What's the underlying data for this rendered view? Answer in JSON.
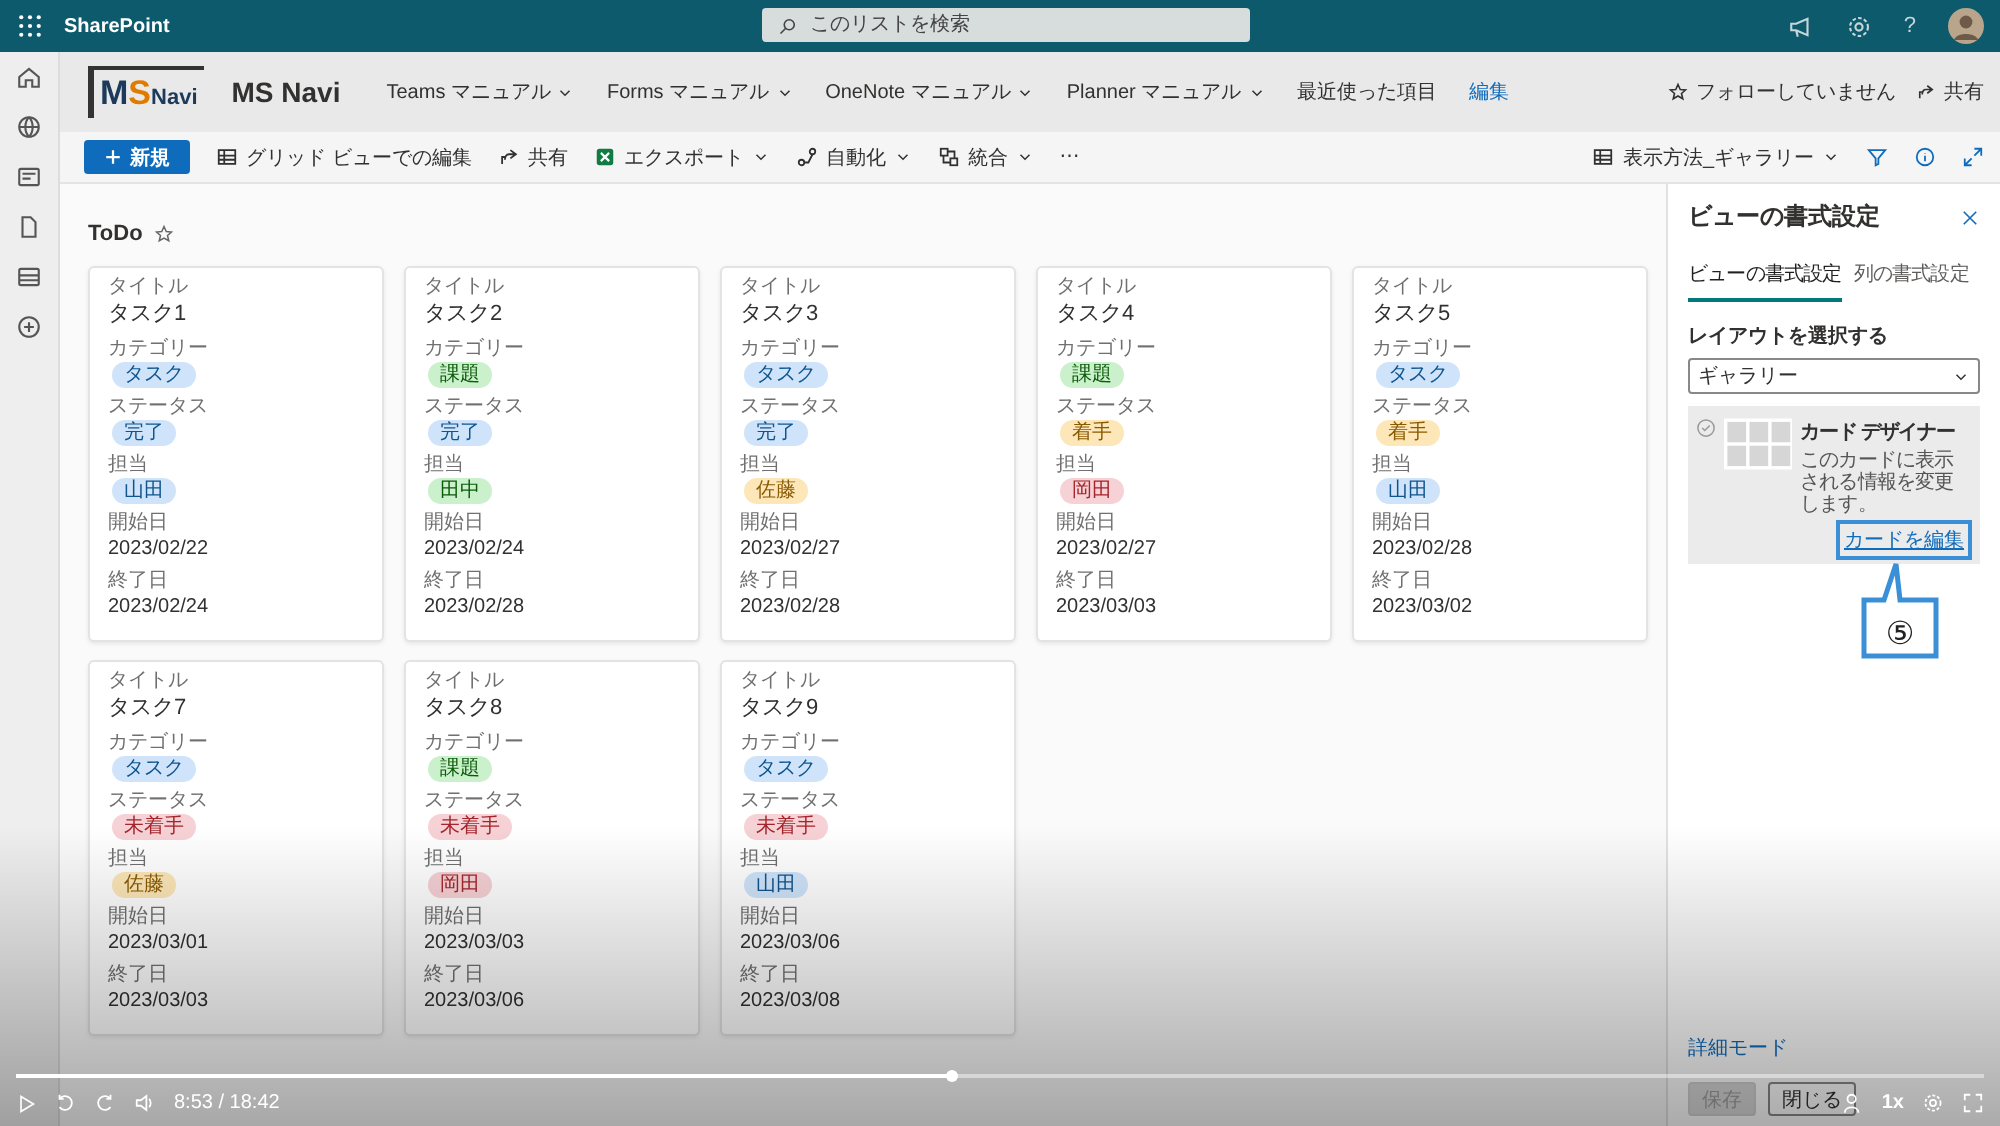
{
  "suite_bar": {
    "app_name": "SharePoint",
    "search": {
      "placeholder": "このリストを検索"
    },
    "help": "?"
  },
  "site_header": {
    "logo": {
      "mark": "M",
      "accent": "S",
      "name": "Navi"
    },
    "title": "MS Navi",
    "nav": [
      {
        "label": "Teams マニュアル",
        "kind": "menu"
      },
      {
        "label": "Forms マニュアル",
        "kind": "menu"
      },
      {
        "label": "OneNote マニュアル",
        "kind": "menu"
      },
      {
        "label": "Planner マニュアル",
        "kind": "menu"
      },
      {
        "label": "最近使った項目",
        "kind": "plain"
      },
      {
        "label": "編集",
        "kind": "link"
      }
    ],
    "follow": "フォローしていません",
    "share": "共有"
  },
  "command_bar": {
    "items": [
      {
        "label": "新規",
        "kind": "new"
      },
      {
        "label": "グリッド ビューでの編集",
        "kind": "grid"
      },
      {
        "label": "共有",
        "kind": "share"
      },
      {
        "label": "エクスポート",
        "kind": "excel"
      },
      {
        "label": "自動化",
        "kind": "automate"
      },
      {
        "label": "統合",
        "kind": "integrate"
      },
      {
        "label": "⋯",
        "kind": "more"
      }
    ],
    "view": "表示方法_ギャラリー"
  },
  "list": {
    "title": "ToDo",
    "favorite": false
  },
  "cards": [
    {
      "fields": [
        {
          "label": "タイトル",
          "value": "タスク1",
          "kind": "title"
        },
        {
          "label": "カテゴリー",
          "value": "タスク",
          "kind": "chip",
          "color": "#cfe4fa"
        },
        {
          "label": "ステータス",
          "value": "完了",
          "kind": "chip",
          "color": "#cfe4fa"
        },
        {
          "label": "担当",
          "value": "山田",
          "kind": "chip",
          "color": "#cfe4fa"
        },
        {
          "label": "開始日",
          "value": "2023/02/22",
          "kind": "text"
        },
        {
          "label": "終了日",
          "value": "2023/02/24",
          "kind": "text"
        }
      ]
    },
    {
      "fields": [
        {
          "label": "タイトル",
          "value": "タスク2",
          "kind": "title"
        },
        {
          "label": "カテゴリー",
          "value": "課題",
          "kind": "chip",
          "color": "#caf0cc"
        },
        {
          "label": "ステータス",
          "value": "完了",
          "kind": "chip",
          "color": "#cfe4fa"
        },
        {
          "label": "担当",
          "value": "田中",
          "kind": "chip",
          "color": "#caf0cc"
        },
        {
          "label": "開始日",
          "value": "2023/02/24",
          "kind": "text"
        },
        {
          "label": "終了日",
          "value": "2023/02/28",
          "kind": "text"
        }
      ]
    },
    {
      "fields": [
        {
          "label": "タイトル",
          "value": "タスク3",
          "kind": "title"
        },
        {
          "label": "カテゴリー",
          "value": "タスク",
          "kind": "chip",
          "color": "#cfe4fa"
        },
        {
          "label": "ステータス",
          "value": "完了",
          "kind": "chip",
          "color": "#cfe4fa"
        },
        {
          "label": "担当",
          "value": "佐藤",
          "kind": "chip",
          "color": "#fde7b8"
        },
        {
          "label": "開始日",
          "value": "2023/02/27",
          "kind": "text"
        },
        {
          "label": "終了日",
          "value": "2023/02/28",
          "kind": "text"
        }
      ]
    },
    {
      "fields": [
        {
          "label": "タイトル",
          "value": "タスク4",
          "kind": "title"
        },
        {
          "label": "カテゴリー",
          "value": "課題",
          "kind": "chip",
          "color": "#caf0cc"
        },
        {
          "label": "ステータス",
          "value": "着手",
          "kind": "chip",
          "color": "#fde7b8"
        },
        {
          "label": "担当",
          "value": "岡田",
          "kind": "chip",
          "color": "#f6d1d5"
        },
        {
          "label": "開始日",
          "value": "2023/02/27",
          "kind": "text"
        },
        {
          "label": "終了日",
          "value": "2023/03/03",
          "kind": "text"
        }
      ]
    },
    {
      "fields": [
        {
          "label": "タイトル",
          "value": "タスク5",
          "kind": "title"
        },
        {
          "label": "カテゴリー",
          "value": "タスク",
          "kind": "chip",
          "color": "#cfe4fa"
        },
        {
          "label": "ステータス",
          "value": "着手",
          "kind": "chip",
          "color": "#fde7b8"
        },
        {
          "label": "担当",
          "value": "山田",
          "kind": "chip",
          "color": "#cfe4fa"
        },
        {
          "label": "開始日",
          "value": "2023/02/28",
          "kind": "text"
        },
        {
          "label": "終了日",
          "value": "2023/03/02",
          "kind": "text"
        }
      ]
    },
    {
      "fields": [
        {
          "label": "タイトル",
          "value": "タスク7",
          "kind": "title"
        },
        {
          "label": "カテゴリー",
          "value": "タスク",
          "kind": "chip",
          "color": "#cfe4fa"
        },
        {
          "label": "ステータス",
          "value": "未着手",
          "kind": "chip",
          "color": "#f6d1d5"
        },
        {
          "label": "担当",
          "value": "佐藤",
          "kind": "chip",
          "color": "#fde7b8"
        },
        {
          "label": "開始日",
          "value": "2023/03/01",
          "kind": "text"
        },
        {
          "label": "終了日",
          "value": "2023/03/03",
          "kind": "text"
        }
      ]
    },
    {
      "fields": [
        {
          "label": "タイトル",
          "value": "タスク8",
          "kind": "title"
        },
        {
          "label": "カテゴリー",
          "value": "課題",
          "kind": "chip",
          "color": "#caf0cc"
        },
        {
          "label": "ステータス",
          "value": "未着手",
          "kind": "chip",
          "color": "#f6d1d5"
        },
        {
          "label": "担当",
          "value": "岡田",
          "kind": "chip",
          "color": "#f6d1d5"
        },
        {
          "label": "開始日",
          "value": "2023/03/03",
          "kind": "text"
        },
        {
          "label": "終了日",
          "value": "2023/03/06",
          "kind": "text"
        }
      ]
    },
    {
      "fields": [
        {
          "label": "タイトル",
          "value": "タスク9",
          "kind": "title"
        },
        {
          "label": "カテゴリー",
          "value": "タスク",
          "kind": "chip",
          "color": "#cfe4fa"
        },
        {
          "label": "ステータス",
          "value": "未着手",
          "kind": "chip",
          "color": "#f6d1d5"
        },
        {
          "label": "担当",
          "value": "山田",
          "kind": "chip",
          "color": "#cfe4fa"
        },
        {
          "label": "開始日",
          "value": "2023/03/06",
          "kind": "text"
        },
        {
          "label": "終了日",
          "value": "2023/03/08",
          "kind": "text"
        }
      ]
    }
  ],
  "format_panel": {
    "title": "ビューの書式設定",
    "tabs": [
      {
        "label": "ビューの書式設定",
        "selected": true
      },
      {
        "label": "列の書式設定",
        "selected": false
      }
    ],
    "layout_label": "レイアウトを選択する",
    "layout_select": {
      "value": "ギャラリー"
    },
    "designer": {
      "title": "カード デザイナー",
      "description": "このカードに表示される情報を変更します。",
      "edit_link": "カードを編集",
      "checked": false
    },
    "advanced_link": "詳細モード",
    "buttons": [
      {
        "label": "保存",
        "disabled": true
      },
      {
        "label": "閉じる",
        "disabled": false
      }
    ]
  },
  "annotation": {
    "number": "⑤"
  },
  "player": {
    "level": 0.476,
    "time": "8:53 / 18:42",
    "speed": "1x"
  }
}
